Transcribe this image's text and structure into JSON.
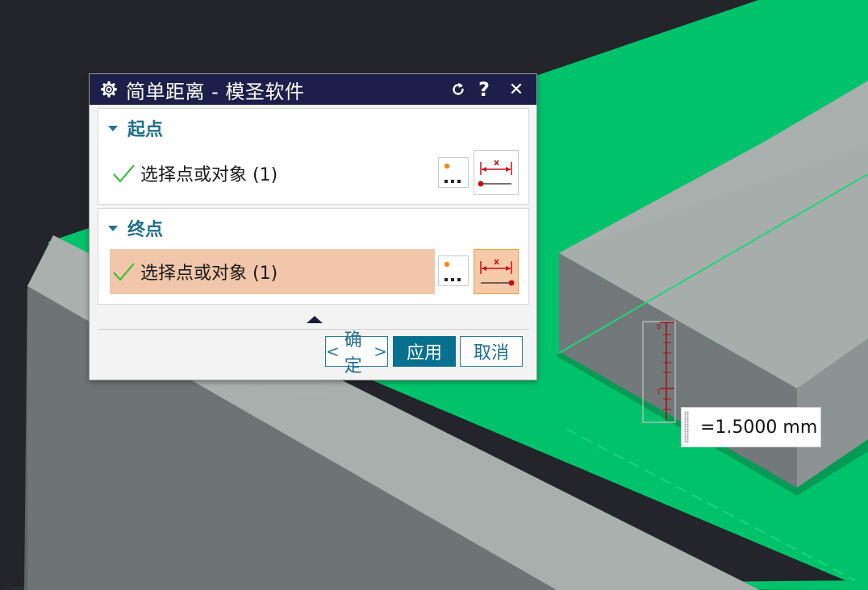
{
  "dialog": {
    "title": "简单距离 - 模圣软件",
    "icons": {
      "settings": "gear-icon",
      "reset": "reset-icon",
      "help": "help-icon",
      "close": "close-icon"
    },
    "help_glyph": "?",
    "close_glyph": "✕",
    "start_point": {
      "title": "起点",
      "selection_label": "选择点或对象 (1)",
      "active": false
    },
    "end_point": {
      "title": "终点",
      "selection_label": "选择点或对象 (1)",
      "active": true
    },
    "point_dialog_dots": "...",
    "distance_icon_letter": "x",
    "buttons": {
      "ok_label": "确定",
      "ok_left": "<",
      "ok_right": ">",
      "apply_label": "应用",
      "cancel_label": "取消"
    }
  },
  "measurement": {
    "readout": "=1.5000 mm",
    "ruler_labels": [
      "0",
      "1"
    ]
  },
  "colors": {
    "title_bar": "#1d1f4a",
    "accent": "#07708e",
    "group_title": "#1e6e8a",
    "active_row": "#f2c6aa",
    "green_surface": "#00c26b",
    "background": "#23252b"
  }
}
